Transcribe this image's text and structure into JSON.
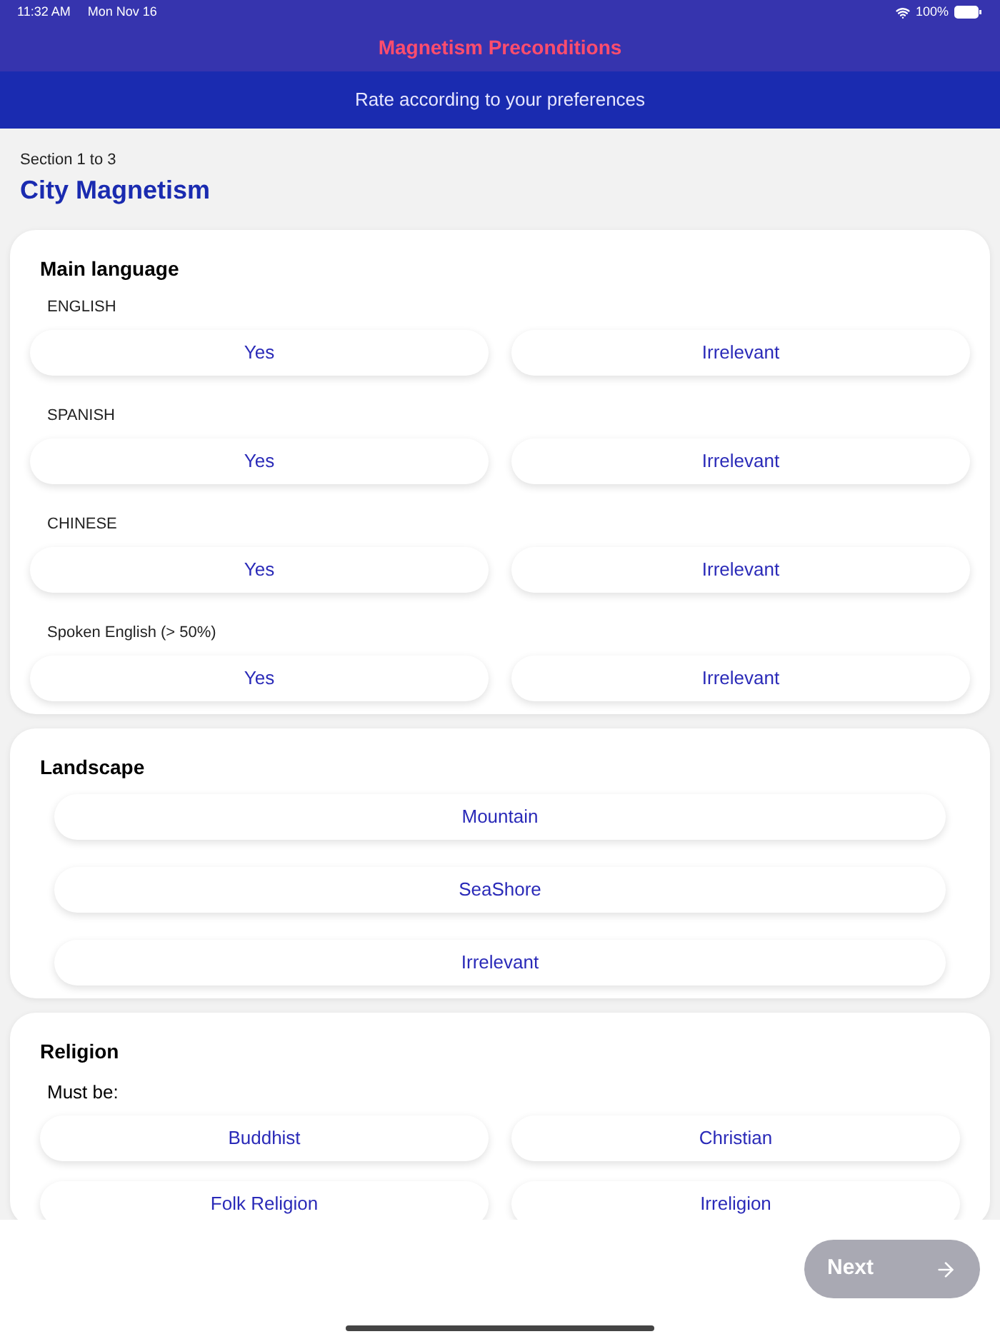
{
  "status_bar": {
    "time": "11:32 AM",
    "date": "Mon Nov 16",
    "battery": "100%"
  },
  "header": {
    "title": "Magnetism Preconditions",
    "subtitle": "Rate according to your preferences"
  },
  "section_label": "Section 1 to 3",
  "page_title": "City Magnetism",
  "cards": [
    {
      "kind": "pairs",
      "title": "Main language",
      "questions": [
        {
          "label": "ENGLISH",
          "options": [
            "Yes",
            "Irrelevant"
          ]
        },
        {
          "label": "SPANISH",
          "options": [
            "Yes",
            "Irrelevant"
          ]
        },
        {
          "label": "CHINESE",
          "options": [
            "Yes",
            "Irrelevant"
          ]
        },
        {
          "label": "Spoken English (> 50%)",
          "options": [
            "Yes",
            "Irrelevant"
          ]
        }
      ]
    },
    {
      "kind": "single",
      "title": "Landscape",
      "options": [
        "Mountain",
        "SeaShore",
        "Irrelevant"
      ]
    },
    {
      "kind": "grid",
      "title": "Religion",
      "subtitle": "Must be:",
      "options": [
        "Buddhist",
        "Christian",
        "Folk Religion",
        "Irreligion"
      ]
    }
  ],
  "next_button": {
    "label": "Next",
    "disabled": true
  }
}
